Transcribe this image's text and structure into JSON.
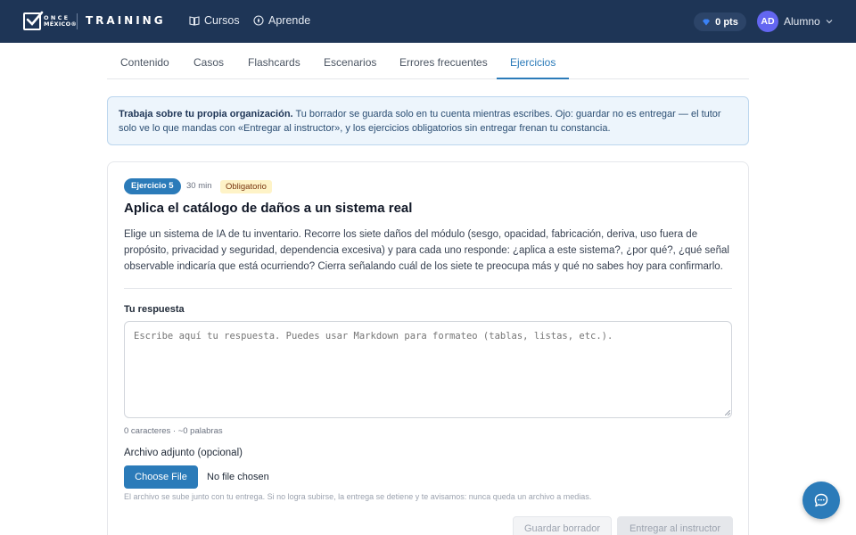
{
  "header": {
    "logo_line1": "ONCE",
    "logo_line2": "MÉXICO®",
    "brand": "TRAINING",
    "nav": [
      {
        "label": "Cursos",
        "icon": "book-icon"
      },
      {
        "label": "Aprende",
        "icon": "compass-icon"
      }
    ],
    "points": "0 pts",
    "avatar_initials": "AD",
    "user_name": "Alumno"
  },
  "tabs": [
    "Contenido",
    "Casos",
    "Flashcards",
    "Escenarios",
    "Errores frecuentes",
    "Ejercicios"
  ],
  "active_tab": "Ejercicios",
  "banner": {
    "strong": "Trabaja sobre tu propia organización.",
    "text": " Tu borrador se guarda solo en tu cuenta mientras escribes. Ojo: guardar no es entregar — el tutor solo ve lo que mandas con «Entregar al instructor», y los ejercicios obligatorios sin entregar frenan tu constancia."
  },
  "exercise": {
    "badge": "Ejercicio 5",
    "duration": "30 min",
    "tag": "Obligatorio",
    "title": "Aplica el catálogo de daños a un sistema real",
    "description": "Elige un sistema de IA de tu inventario. Recorre los siete daños del módulo (sesgo, opacidad, fabricación, deriva, uso fuera de propósito, privacidad y seguridad, dependencia excesiva) y para cada uno responde: ¿aplica a este sistema?, ¿por qué?, ¿qué señal observable indicaría que está ocurriendo? Cierra señalando cuál de los siete te preocupa más y qué no sabes hoy para confirmarlo.",
    "response_label": "Tu respuesta",
    "response_placeholder": "Escribe aquí tu respuesta. Puedes usar Markdown para formateo (tablas, listas, etc.).",
    "response_value": "",
    "counter": "0 caracteres · ~0 palabras",
    "file_label": "Archivo adjunto (opcional)",
    "choose_file": "Choose File",
    "no_file": "No file chosen",
    "file_help": "El archivo se sube junto con tu entrega. Si no logra subirse, la entrega se detiene y te avisamos: nunca queda un archivo a medias.",
    "save_draft": "Guardar borrador",
    "submit": "Entregar al instructor"
  },
  "colors": {
    "header_bg": "#1e3556",
    "accent": "#2b7bb9",
    "banner_bg": "#edf5fc",
    "tag_bg": "#fef3c7"
  }
}
